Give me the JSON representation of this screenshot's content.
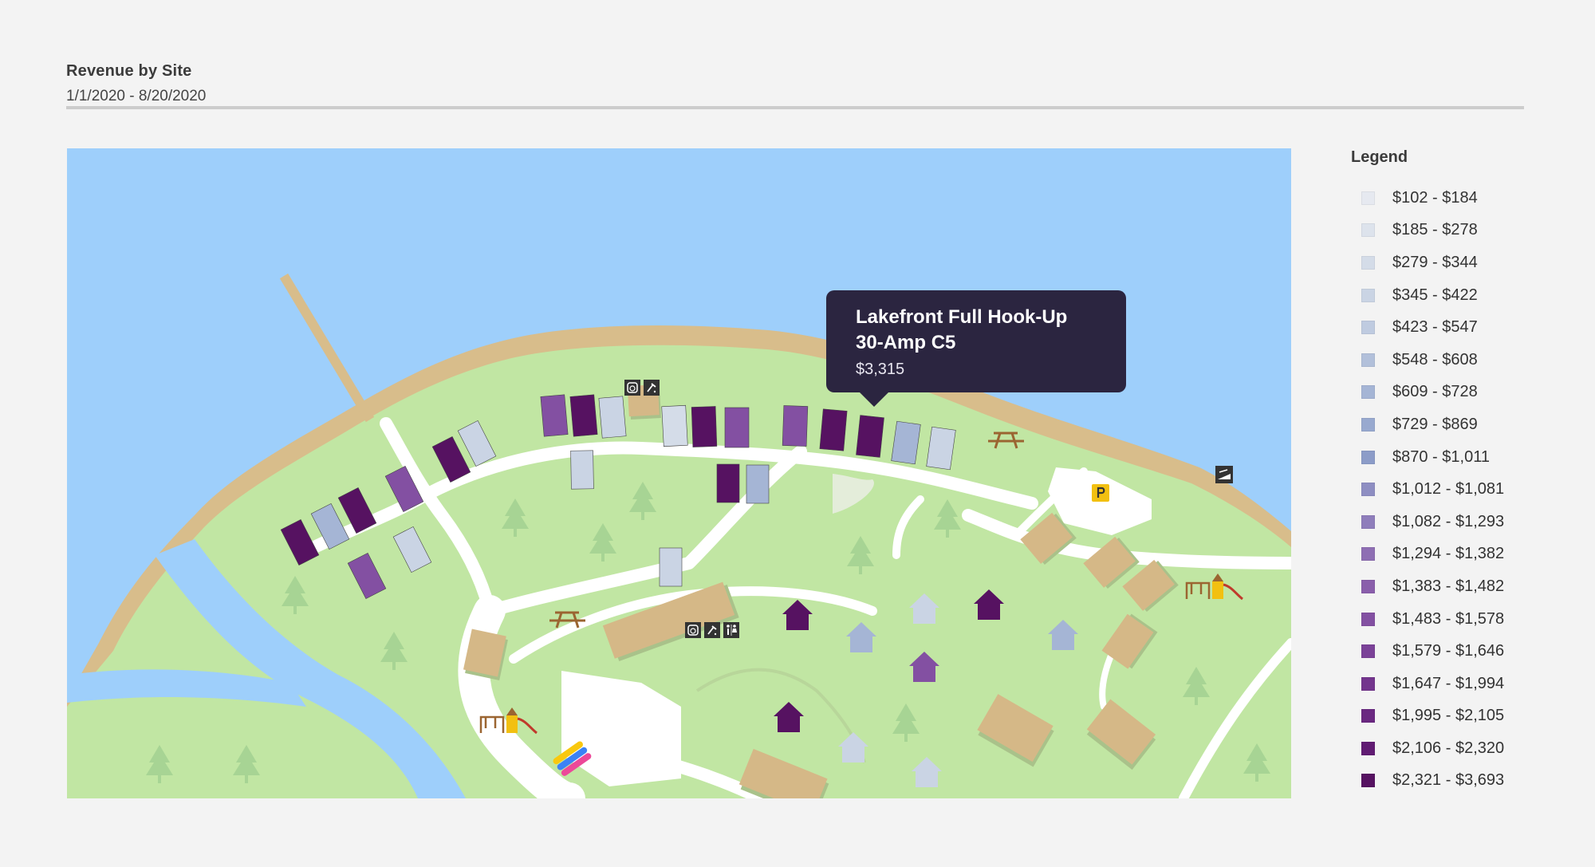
{
  "header": {
    "title": "Revenue by Site",
    "subtitle": "1/1/2020 - 8/20/2020"
  },
  "tooltip": {
    "name": "Lakefront Full Hook-Up 30-Amp C5",
    "value": "$3,315"
  },
  "legend": {
    "title": "Legend",
    "items": [
      {
        "label": "$102 - $184",
        "color": "#e6e9f0"
      },
      {
        "label": "$185 - $278",
        "color": "#dde3ec"
      },
      {
        "label": "$279 - $344",
        "color": "#d4dce8"
      },
      {
        "label": "$345 - $422",
        "color": "#cad4e4"
      },
      {
        "label": "$423 - $547",
        "color": "#bfcbe0"
      },
      {
        "label": "$548 - $608",
        "color": "#b2c0da"
      },
      {
        "label": "$609 - $728",
        "color": "#a5b5d5"
      },
      {
        "label": "$729 - $869",
        "color": "#98a9cf"
      },
      {
        "label": "$870 - $1,011",
        "color": "#8c9cc8"
      },
      {
        "label": "$1,012 - $1,081",
        "color": "#8e8ec2"
      },
      {
        "label": "$1,082 - $1,293",
        "color": "#8f7ebb"
      },
      {
        "label": "$1,294 - $1,382",
        "color": "#8e6eb3"
      },
      {
        "label": "$1,383 - $1,482",
        "color": "#8a5eab"
      },
      {
        "label": "$1,483 - $1,578",
        "color": "#8350a2"
      },
      {
        "label": "$1,579 - $1,646",
        "color": "#7b4298"
      },
      {
        "label": "$1,647 - $1,994",
        "color": "#73358d"
      },
      {
        "label": "$1,995 - $2,105",
        "color": "#6a2881"
      },
      {
        "label": "$2,106 - $2,320",
        "color": "#611c73"
      },
      {
        "label": "$2,321 - $3,693",
        "color": "#561261"
      }
    ]
  },
  "map_icons": [
    "laundry-icon",
    "shower-icon",
    "restroom-icon",
    "parking-icon",
    "boat-ramp-icon",
    "picnic-table-icon",
    "playground-icon",
    "tree-icon",
    "cabin-icon"
  ]
}
